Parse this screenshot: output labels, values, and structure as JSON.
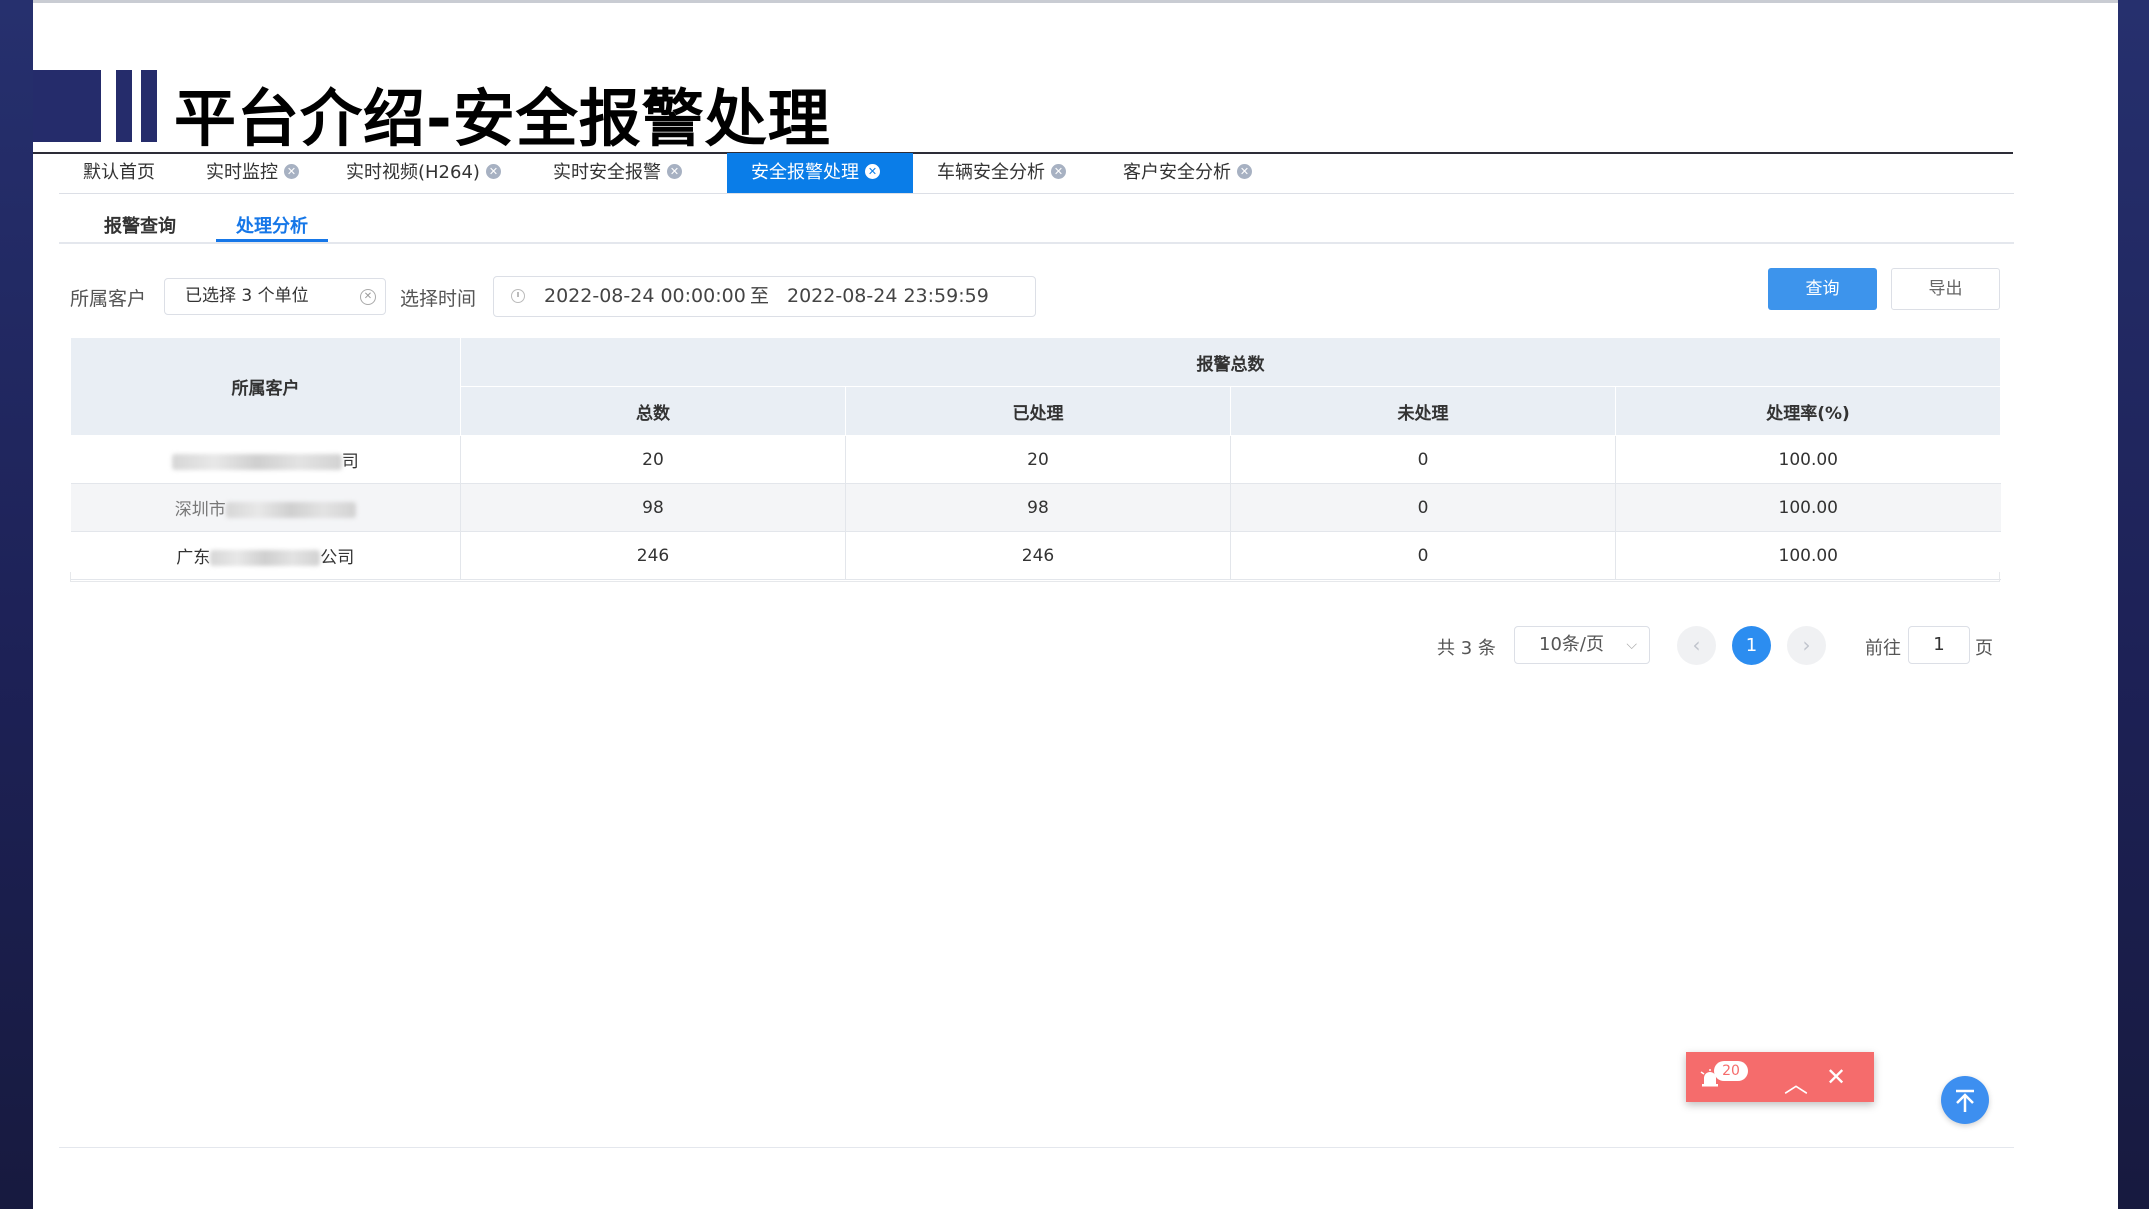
{
  "slide_title": "平台介绍-安全报警处理",
  "tabs": [
    {
      "label": "默认首页",
      "closable": false,
      "active": false
    },
    {
      "label": "实时监控",
      "closable": true,
      "active": false
    },
    {
      "label": "实时视频(H264)",
      "closable": true,
      "active": false
    },
    {
      "label": "实时安全报警",
      "closable": true,
      "active": false
    },
    {
      "label": "安全报警处理",
      "closable": true,
      "active": true
    },
    {
      "label": "车辆安全分析",
      "closable": true,
      "active": false
    },
    {
      "label": "客户安全分析",
      "closable": true,
      "active": false
    }
  ],
  "sub_tabs": [
    {
      "label": "报警查询",
      "active": false
    },
    {
      "label": "处理分析",
      "active": true
    }
  ],
  "filters": {
    "customer_label": "所属客户",
    "customer_value": "已选择 3 个单位",
    "time_label": "选择时间",
    "start_time": "2022-08-24 00:00:00",
    "separator": "至",
    "end_time": "2022-08-24 23:59:59"
  },
  "buttons": {
    "query": "查询",
    "export": "导出"
  },
  "table": {
    "group_header": "报警总数",
    "headers": {
      "customer": "所属客户",
      "total": "总数",
      "handled": "已处理",
      "unhandled": "未处理",
      "rate": "处理率(%)"
    },
    "rows": [
      {
        "customer_prefix": "",
        "customer_suffix": "司",
        "total": "20",
        "handled": "20",
        "unhandled": "0",
        "rate": "100.00"
      },
      {
        "customer_prefix": "深圳市",
        "customer_suffix": "",
        "total": "98",
        "handled": "98",
        "unhandled": "0",
        "rate": "100.00"
      },
      {
        "customer_prefix": "广东",
        "customer_suffix": "公司",
        "total": "246",
        "handled": "246",
        "unhandled": "0",
        "rate": "100.00"
      }
    ]
  },
  "pagination": {
    "total_text": "共 3 条",
    "page_size": "10条/页",
    "current_page": "1",
    "goto_label": "前往",
    "goto_value": "1",
    "page_unit": "页"
  },
  "alarm_widget": {
    "count": "20"
  },
  "colors": {
    "primary": "#0a7de8",
    "frame": "#1d2156",
    "alarm": "#f56c6c"
  },
  "icons": [
    "tab-close-icon",
    "clear-icon",
    "clock-icon",
    "chevron-down-icon",
    "chevron-left-icon",
    "chevron-right-icon",
    "bell-icon",
    "chevron-up-icon",
    "close-icon",
    "back-to-top-icon"
  ]
}
